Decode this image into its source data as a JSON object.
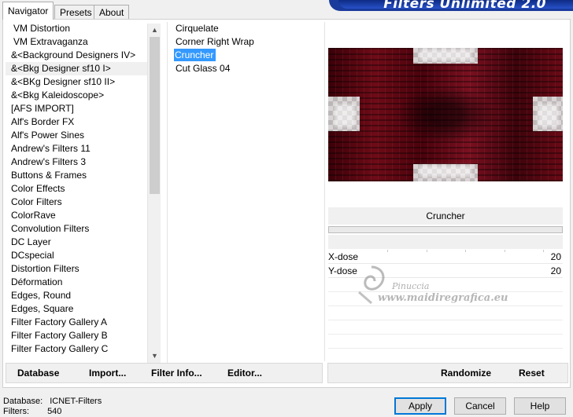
{
  "tabs": [
    {
      "label": "Navigator",
      "active": true
    },
    {
      "label": "Presets",
      "active": false
    },
    {
      "label": "About",
      "active": false
    }
  ],
  "banner": {
    "title": "Filters Unlimited 2.0"
  },
  "categories": [
    "VM Distortion",
    "VM Extravaganza",
    "&<Background Designers IV>",
    "&<Bkg Designer sf10 I>",
    "&<BKg Designer sf10 II>",
    "&<Bkg Kaleidoscope>",
    "[AFS IMPORT]",
    "Alf's Border FX",
    "Alf's Power Sines",
    "Andrew's Filters 11",
    "Andrew's Filters 3",
    "Buttons & Frames",
    "Color Effects",
    "Color Filters",
    "ColorRave",
    "Convolution Filters",
    "DC Layer",
    "DCspecial",
    "Distortion Filters",
    "Déformation",
    "Edges, Round",
    "Edges, Square",
    "Filter Factory Gallery A",
    "Filter Factory Gallery B",
    "Filter Factory Gallery C"
  ],
  "selected_category": "&<Bkg Designer sf10 I>",
  "filters": [
    "Cirquelate",
    "Corner Right Wrap",
    "Cruncher",
    "Cut Glass 04"
  ],
  "selected_filter": "Cruncher",
  "preview": {
    "accent": "#6e0b17"
  },
  "filter_name": "Cruncher",
  "params": [
    {
      "label": "X-dose",
      "value": "20"
    },
    {
      "label": "Y-dose",
      "value": "20"
    }
  ],
  "watermark": {
    "name": "Pinuccia",
    "url": "www.maidiregrafica.eu"
  },
  "left_toolbar": {
    "database": "Database",
    "import": "Import...",
    "filter_info": "Filter Info...",
    "editor": "Editor..."
  },
  "right_toolbar": {
    "randomize": "Randomize",
    "reset": "Reset"
  },
  "status": {
    "database_label": "Database:",
    "database_value": "ICNET-Filters",
    "filters_label": "Filters:",
    "filters_value": "540"
  },
  "dialog": {
    "apply": "Apply",
    "cancel": "Cancel",
    "help": "Help"
  },
  "colors": {
    "selection": "#3399ff",
    "banner": "#1a3a9c",
    "apply_border": "#0078d7"
  }
}
